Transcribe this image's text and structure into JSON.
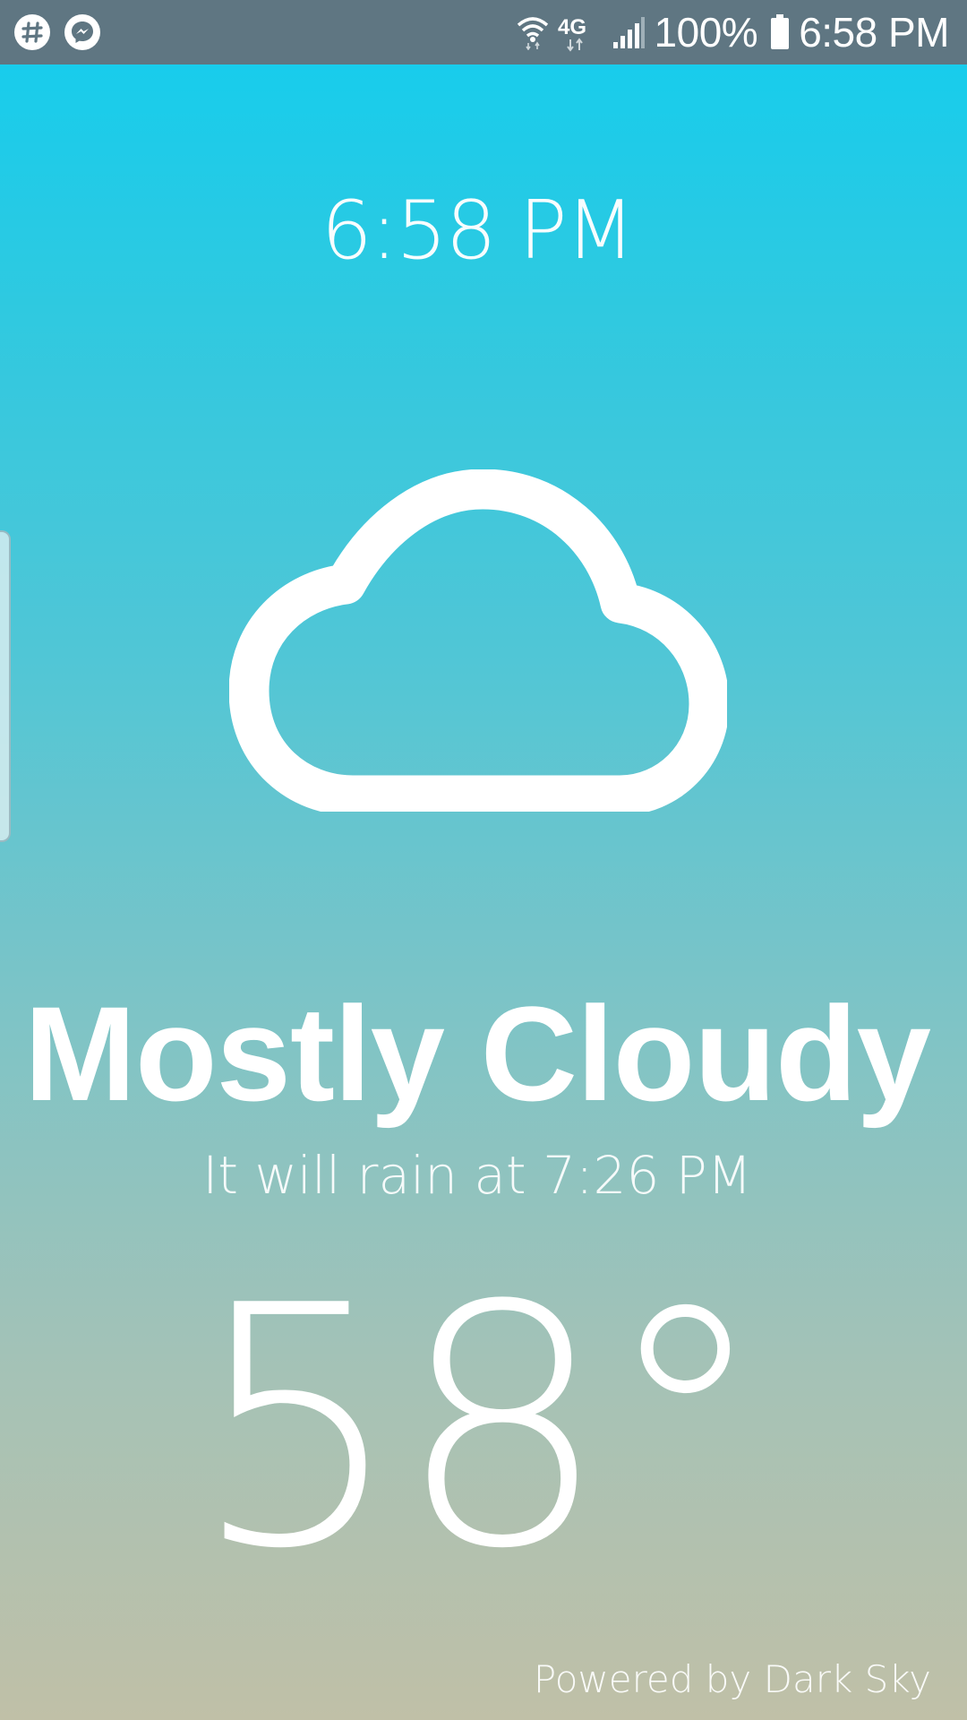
{
  "status_bar": {
    "notifications": [
      {
        "icon": "slack-icon"
      },
      {
        "icon": "messenger-icon"
      }
    ],
    "network_label": "4G",
    "battery_percent": "100%",
    "time": "6:58 PM"
  },
  "weather": {
    "clock_time": "6:58 PM",
    "icon": "cloud-icon",
    "condition": "Mostly Cloudy",
    "summary": "It will rain at 7:26 PM",
    "temperature": "58°"
  },
  "footer": {
    "attribution": "Powered by Dark Sky"
  },
  "colors": {
    "status_bar_bg": "#5f7682",
    "gradient_top": "#12cdef",
    "gradient_bottom": "#c0c0a7",
    "text": "#ffffff"
  }
}
